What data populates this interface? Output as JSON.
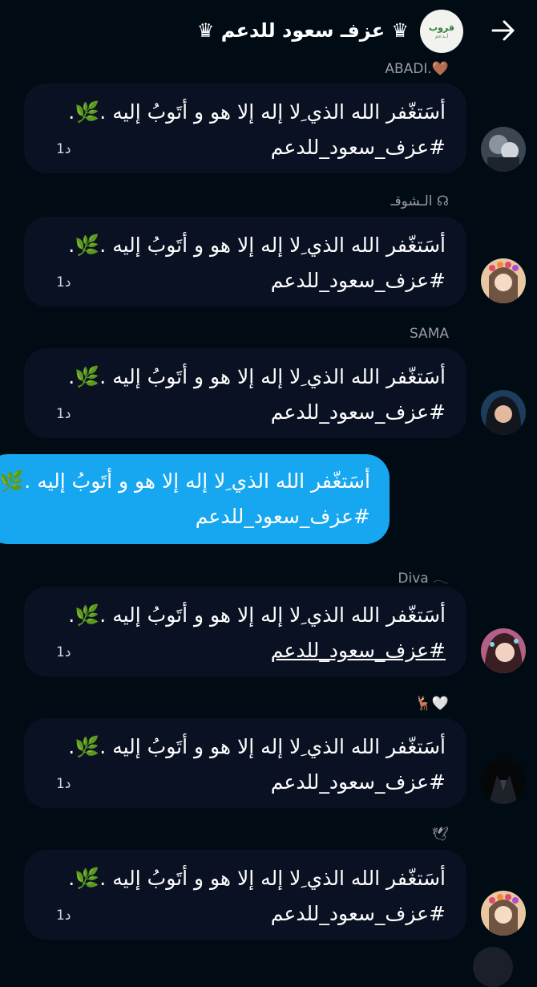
{
  "header": {
    "title": "♛ عزفـ ﺳﻌﻮد للدعم ♛",
    "group_avatar_text": "قروب",
    "group_avatar_subtext": "لـدعم"
  },
  "messages": [
    {
      "sender": "ABADI.🤎",
      "line1": "أسَتغّفر الله الذي ِلا إله إلا هو و أتَوبُ إليه .🌿.",
      "line2": "#عزف_سعود_للدعم",
      "time": "1د"
    },
    {
      "sender": "الـشوقـ ☊",
      "line1": "أسَتغّفر الله الذي ِلا إله إلا هو و أتَوبُ إليه .🌿.",
      "line2": "#عزف_سعود_للدعم",
      "time": "1د"
    },
    {
      "sender": "SAMA",
      "line1": "أسَتغّفر الله الذي ِلا إله إلا هو و أتَوبُ إليه .🌿.",
      "line2": "#عزف_سعود_للدعم",
      "time": "1د"
    },
    {
      "sender": "Diva 𓂃",
      "line1": "أسَتغّفر الله الذي ِلا إله إلا هو و أتَوبُ إليه .🌿.",
      "line2": "#عزف_سعود_للدعم",
      "time": "1د"
    },
    {
      "sender": "🦌🤍",
      "line1": "أسَتغّفر الله الذي ِلا إله إلا هو و أتَوبُ إليه .🌿.",
      "line2": "#عزف_سعود_للدعم",
      "time": "1د"
    },
    {
      "sender": "🕊",
      "line1": "أسَتغّفر الله الذي ِلا إله إلا هو و أتَوبُ إليه .🌿.",
      "line2": "#عزف_سعود_للدعم",
      "time": "1د"
    }
  ],
  "own_message": {
    "line1": "أسَتغّفر الله الذي ِلا إله إلا هو و أتَوبُ إليه .🌿.",
    "line2": "#عزف_سعود_للدعم"
  },
  "colors": {
    "background": "#010b14",
    "bubble": "#091122",
    "own_bubble": "#17a7f1"
  }
}
